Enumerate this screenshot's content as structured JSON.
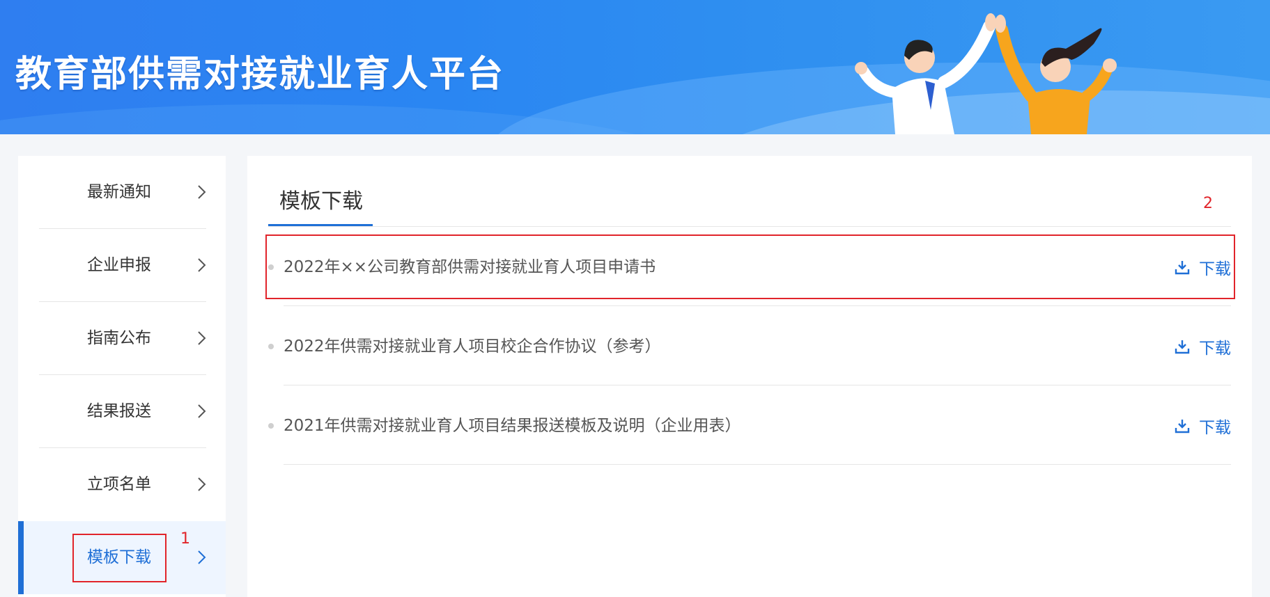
{
  "header": {
    "site_title": "教育部供需对接就业育人平台"
  },
  "sidebar": {
    "items": [
      {
        "label": "最新通知"
      },
      {
        "label": "企业申报"
      },
      {
        "label": "指南公布"
      },
      {
        "label": "结果报送"
      },
      {
        "label": "立项名单"
      },
      {
        "label": "模板下载",
        "active": true
      }
    ]
  },
  "main": {
    "tab_title": "模板下载",
    "files": [
      {
        "name": "2022年××公司教育部供需对接就业育人项目申请书",
        "action": "下载"
      },
      {
        "name": "2022年供需对接就业育人项目校企合作协议（参考）",
        "action": "下载"
      },
      {
        "name": "2021年供需对接就业育人项目结果报送模板及说明（企业用表）",
        "action": "下载"
      }
    ]
  },
  "annotations": {
    "marker1": "1",
    "marker2": "2"
  },
  "colors": {
    "accent": "#1f6fd6",
    "banner": "#2f86f0",
    "annotation": "#e1242a"
  },
  "icons": {
    "nav_arrow": "chevron-right-icon",
    "download": "download-icon"
  }
}
